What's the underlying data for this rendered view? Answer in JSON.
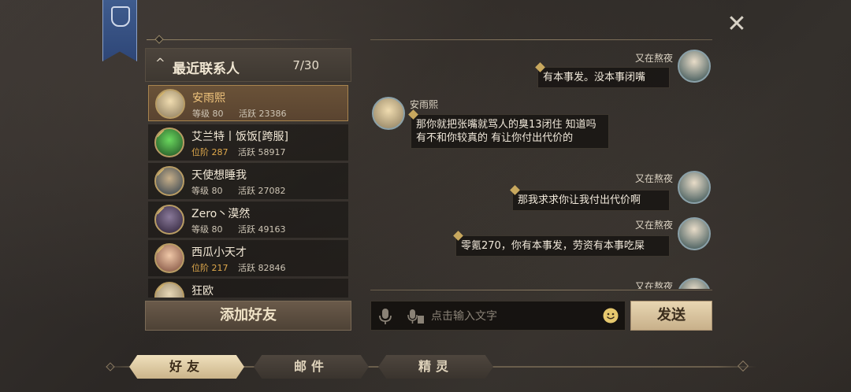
{
  "close_label": "✕",
  "recent": {
    "title": "最近联系人",
    "count": "7/30",
    "contacts": [
      {
        "name": "安雨熙",
        "level": "等级 80",
        "activity": "活跃 23386",
        "level_gold": false,
        "selected": true,
        "avatar_color": "#d9c08a"
      },
      {
        "name": "艾兰特丨饭饭[跨服]",
        "level": "位阶 287",
        "activity": "活跃 58917",
        "level_gold": true,
        "selected": false,
        "avatar_color": "#4fb84c"
      },
      {
        "name": "天使想睡我",
        "level": "等级 80",
        "activity": "活跃 27082",
        "level_gold": false,
        "selected": false,
        "avatar_color": "#7a6a52"
      },
      {
        "name": "Zero丶漠然",
        "level": "等级 80",
        "activity": "活跃 49163",
        "level_gold": false,
        "selected": false,
        "avatar_color": "#3a3048"
      },
      {
        "name": "西瓜小天才",
        "level": "位阶 217",
        "activity": "活跃 82846",
        "level_gold": true,
        "selected": false,
        "avatar_color": "#c88870"
      },
      {
        "name": "狂欧",
        "level": "",
        "activity": "",
        "level_gold": false,
        "selected": false,
        "avatar_color": "#bca888"
      }
    ],
    "add_friend_label": "添加好友"
  },
  "chat": {
    "messages": [
      {
        "sender": "又在熬夜",
        "text": "有本事发。没本事闭嘴",
        "side": "right"
      },
      {
        "sender": "安雨熙",
        "text": "那你就把张嘴就骂人的臭13闭住 知道吗 有不和你较真的 有让你付出代价的",
        "side": "left"
      },
      {
        "sender": "又在熬夜",
        "text": "那我求求你让我付出代价啊",
        "side": "right"
      },
      {
        "sender": "又在熬夜",
        "text": "零氪270，你有本事发，劳资有本事吃屎",
        "side": "right"
      },
      {
        "sender": "又在熬夜",
        "text": "",
        "side": "right"
      }
    ],
    "input_placeholder": "点击输入文字",
    "send_label": "发送"
  },
  "tabs": [
    {
      "label": "好友",
      "active": true
    },
    {
      "label": "邮件",
      "active": false
    },
    {
      "label": "精灵",
      "active": false
    }
  ],
  "colors": {
    "accent_gold": "#c8a85e",
    "banner_blue": "#3f5c8e",
    "selected_row": "#6a5238"
  }
}
